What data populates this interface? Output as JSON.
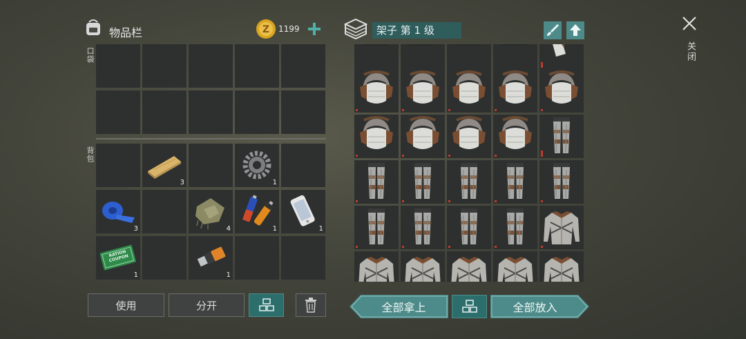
{
  "inventory": {
    "title": "物品栏",
    "coins": "1199",
    "pocket_label": "口袋",
    "backpack_label": "背包",
    "items": [
      {
        "name": "wood-plank-icon",
        "count": "3"
      },
      {
        "name": "gear-icon",
        "count": "1"
      },
      {
        "name": "duct-tape-icon",
        "count": "3"
      },
      {
        "name": "cloth-icon",
        "count": "4"
      },
      {
        "name": "battery-icon",
        "count": "1"
      },
      {
        "name": "smartphone-icon",
        "count": "1"
      },
      {
        "name": "ration-coupon-icon",
        "count": "1",
        "coupon_text": "RATION COUPON"
      },
      {
        "name": "usb-drive-icon",
        "count": "1"
      }
    ]
  },
  "buttons": {
    "use": "使用",
    "split": "分开",
    "take_all": "全部拿上",
    "put_all": "全部放入"
  },
  "container": {
    "title": "架子 第 1 级"
  },
  "close": {
    "label": "关闭"
  },
  "colors": {
    "teal": "#4d8b8a",
    "damage": "#c23a2a",
    "coin": "#d9a520"
  }
}
